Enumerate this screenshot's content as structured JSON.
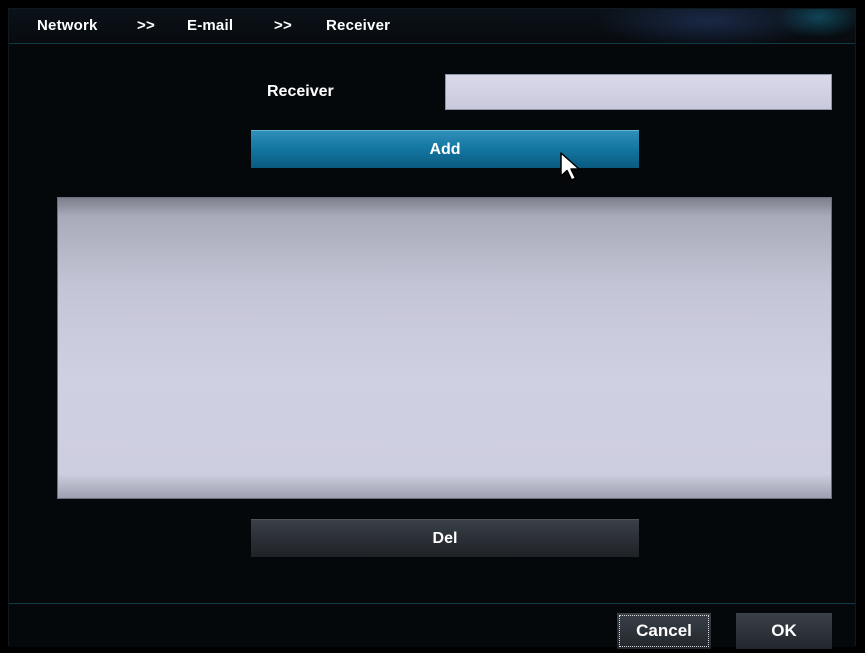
{
  "breadcrumb": {
    "items": [
      "Network",
      "E-mail",
      "Receiver"
    ],
    "separator": ">>"
  },
  "form": {
    "receiver_label": "Receiver",
    "receiver_value": "",
    "add_label": "Add",
    "del_label": "Del"
  },
  "receiver_list": {
    "entries": []
  },
  "footer": {
    "cancel_label": "Cancel",
    "ok_label": "OK"
  },
  "colors": {
    "accent_button": "#1478a3",
    "list_background": "#cfd0e2",
    "panel_background": "#04080b"
  },
  "icons": {
    "cursor": "mouse-pointer-icon"
  }
}
